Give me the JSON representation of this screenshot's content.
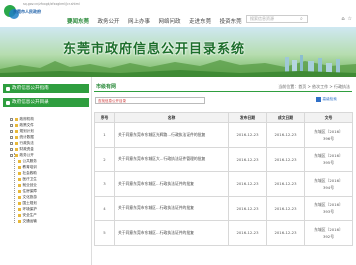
{
  "header": {
    "url": "sq.gov.cn/zfxxgk/zfxxgkml/jcr.shtml",
    "logo_text": "东莞市人民政府",
    "nav": [
      "要闻东莞",
      "政务公开",
      "网上办事",
      "网络问政",
      "走进东莞",
      "投资东莞"
    ],
    "search_placeholder": "搜索信息资源",
    "icons": [
      "home-icon",
      "star-icon"
    ]
  },
  "banner": {
    "title": "东莞市政府信息公开目录系统"
  },
  "sidebar": {
    "buttons": [
      "政府信息公开指南",
      "政府信息公开目录"
    ],
    "tree": [
      "政府机构",
      "政策文件",
      "规划计划",
      "统计数据",
      "行政执法",
      "财政资金",
      "政务公开",
      "公共服务",
      "教育培训",
      "社会救助",
      "医疗卫生",
      "就业创业",
      "住房保障",
      "文化旅游",
      "国土规划",
      "环境保护",
      "安全生产",
      "交通运输"
    ]
  },
  "content": {
    "section_title": "市级有网",
    "breadcrumb": "当前位置：首页 > 依次工作 > 行政执法",
    "query_placeholder": "查找信息公开目录",
    "query_button": "高级检索",
    "table": {
      "headers": [
        "序号",
        "名称",
        "发布日期",
        "成文日期",
        "文号"
      ],
      "rows": [
        {
          "no": "1",
          "name": "关于同意东莞市东城区光辉路…行政执法证件的批复",
          "pub": "2016-12-23",
          "doc_date": "2016-12-23",
          "num_a": "东城区〔2016〕",
          "num_b": "396号"
        },
        {
          "no": "2",
          "name": "关于同意东莞市东城区大…行政执法证件管理的批复",
          "pub": "2016-12-23",
          "doc_date": "2016-12-23",
          "num_a": "东城区〔2016〕",
          "num_b": "395号"
        },
        {
          "no": "3",
          "name": "关于同意东莞市东城区…行政执法证件的批复",
          "pub": "2016-12-23",
          "doc_date": "2016-12-23",
          "num_a": "东城区〔2016〕",
          "num_b": "394号"
        },
        {
          "no": "4",
          "name": "关于同意东莞市东城区…行政执法证件的批复",
          "pub": "2016-12-23",
          "doc_date": "2016-12-23",
          "num_a": "东城区〔2016〕",
          "num_b": "393号"
        },
        {
          "no": "5",
          "name": "关于同意东莞市东城区…行政执法证件的批复",
          "pub": "2016-12-23",
          "doc_date": "2016-12-23",
          "num_a": "东城区〔2016〕",
          "num_b": "392号"
        }
      ]
    }
  },
  "colors": {
    "brand_green": "#2f9e3f",
    "link_blue": "#2f6fc7"
  }
}
